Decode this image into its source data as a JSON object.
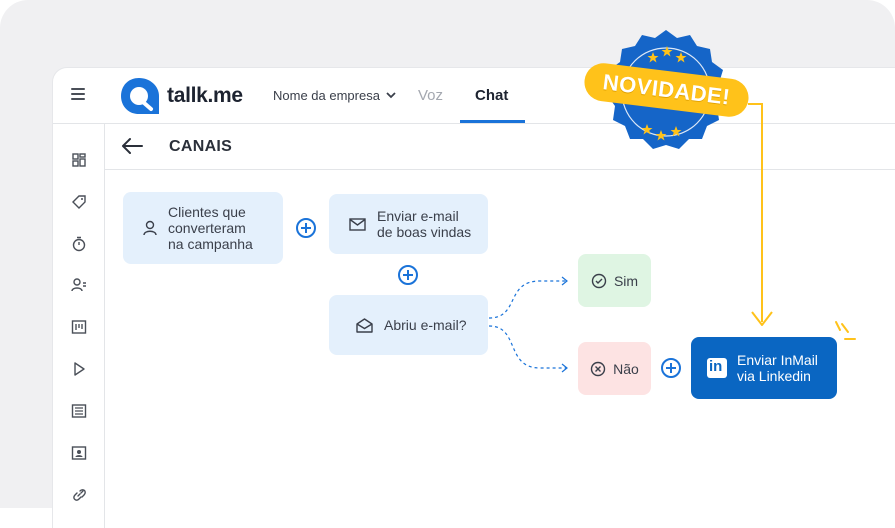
{
  "header": {
    "brand": "tallk.me",
    "company_selector": "Nome da empresa",
    "tabs": [
      {
        "label": "Voz",
        "active": false
      },
      {
        "label": "Chat",
        "active": true
      }
    ]
  },
  "sidebar": {
    "icons": [
      "dashboard-icon",
      "tag-icon",
      "timer-icon",
      "contacts-list-icon",
      "kanban-icon",
      "play-icon",
      "list-icon",
      "contact-folder-icon",
      "link-icon"
    ]
  },
  "page": {
    "title": "CANAIS"
  },
  "flow": {
    "trigger": {
      "line1": "Clientes que",
      "line2": "converteram",
      "line3": "na campanha"
    },
    "email": {
      "line1": "Enviar e-mail",
      "line2": "de boas vindas"
    },
    "question": "Abriu e-mail?",
    "yes": "Sim",
    "no": "Não",
    "linkedin": {
      "line1": "Enviar InMail",
      "line2": "via Linkedin"
    }
  },
  "badge": {
    "text": "NOVIDADE!"
  },
  "colors": {
    "accent": "#1a73d9",
    "linkedin": "#0a66c2",
    "badge_yellow": "#ffc21a",
    "badge_blue": "#1565c8",
    "node_bg": "#e4f0fc",
    "yes_bg": "#dff5e3",
    "no_bg": "#fde3e3"
  }
}
